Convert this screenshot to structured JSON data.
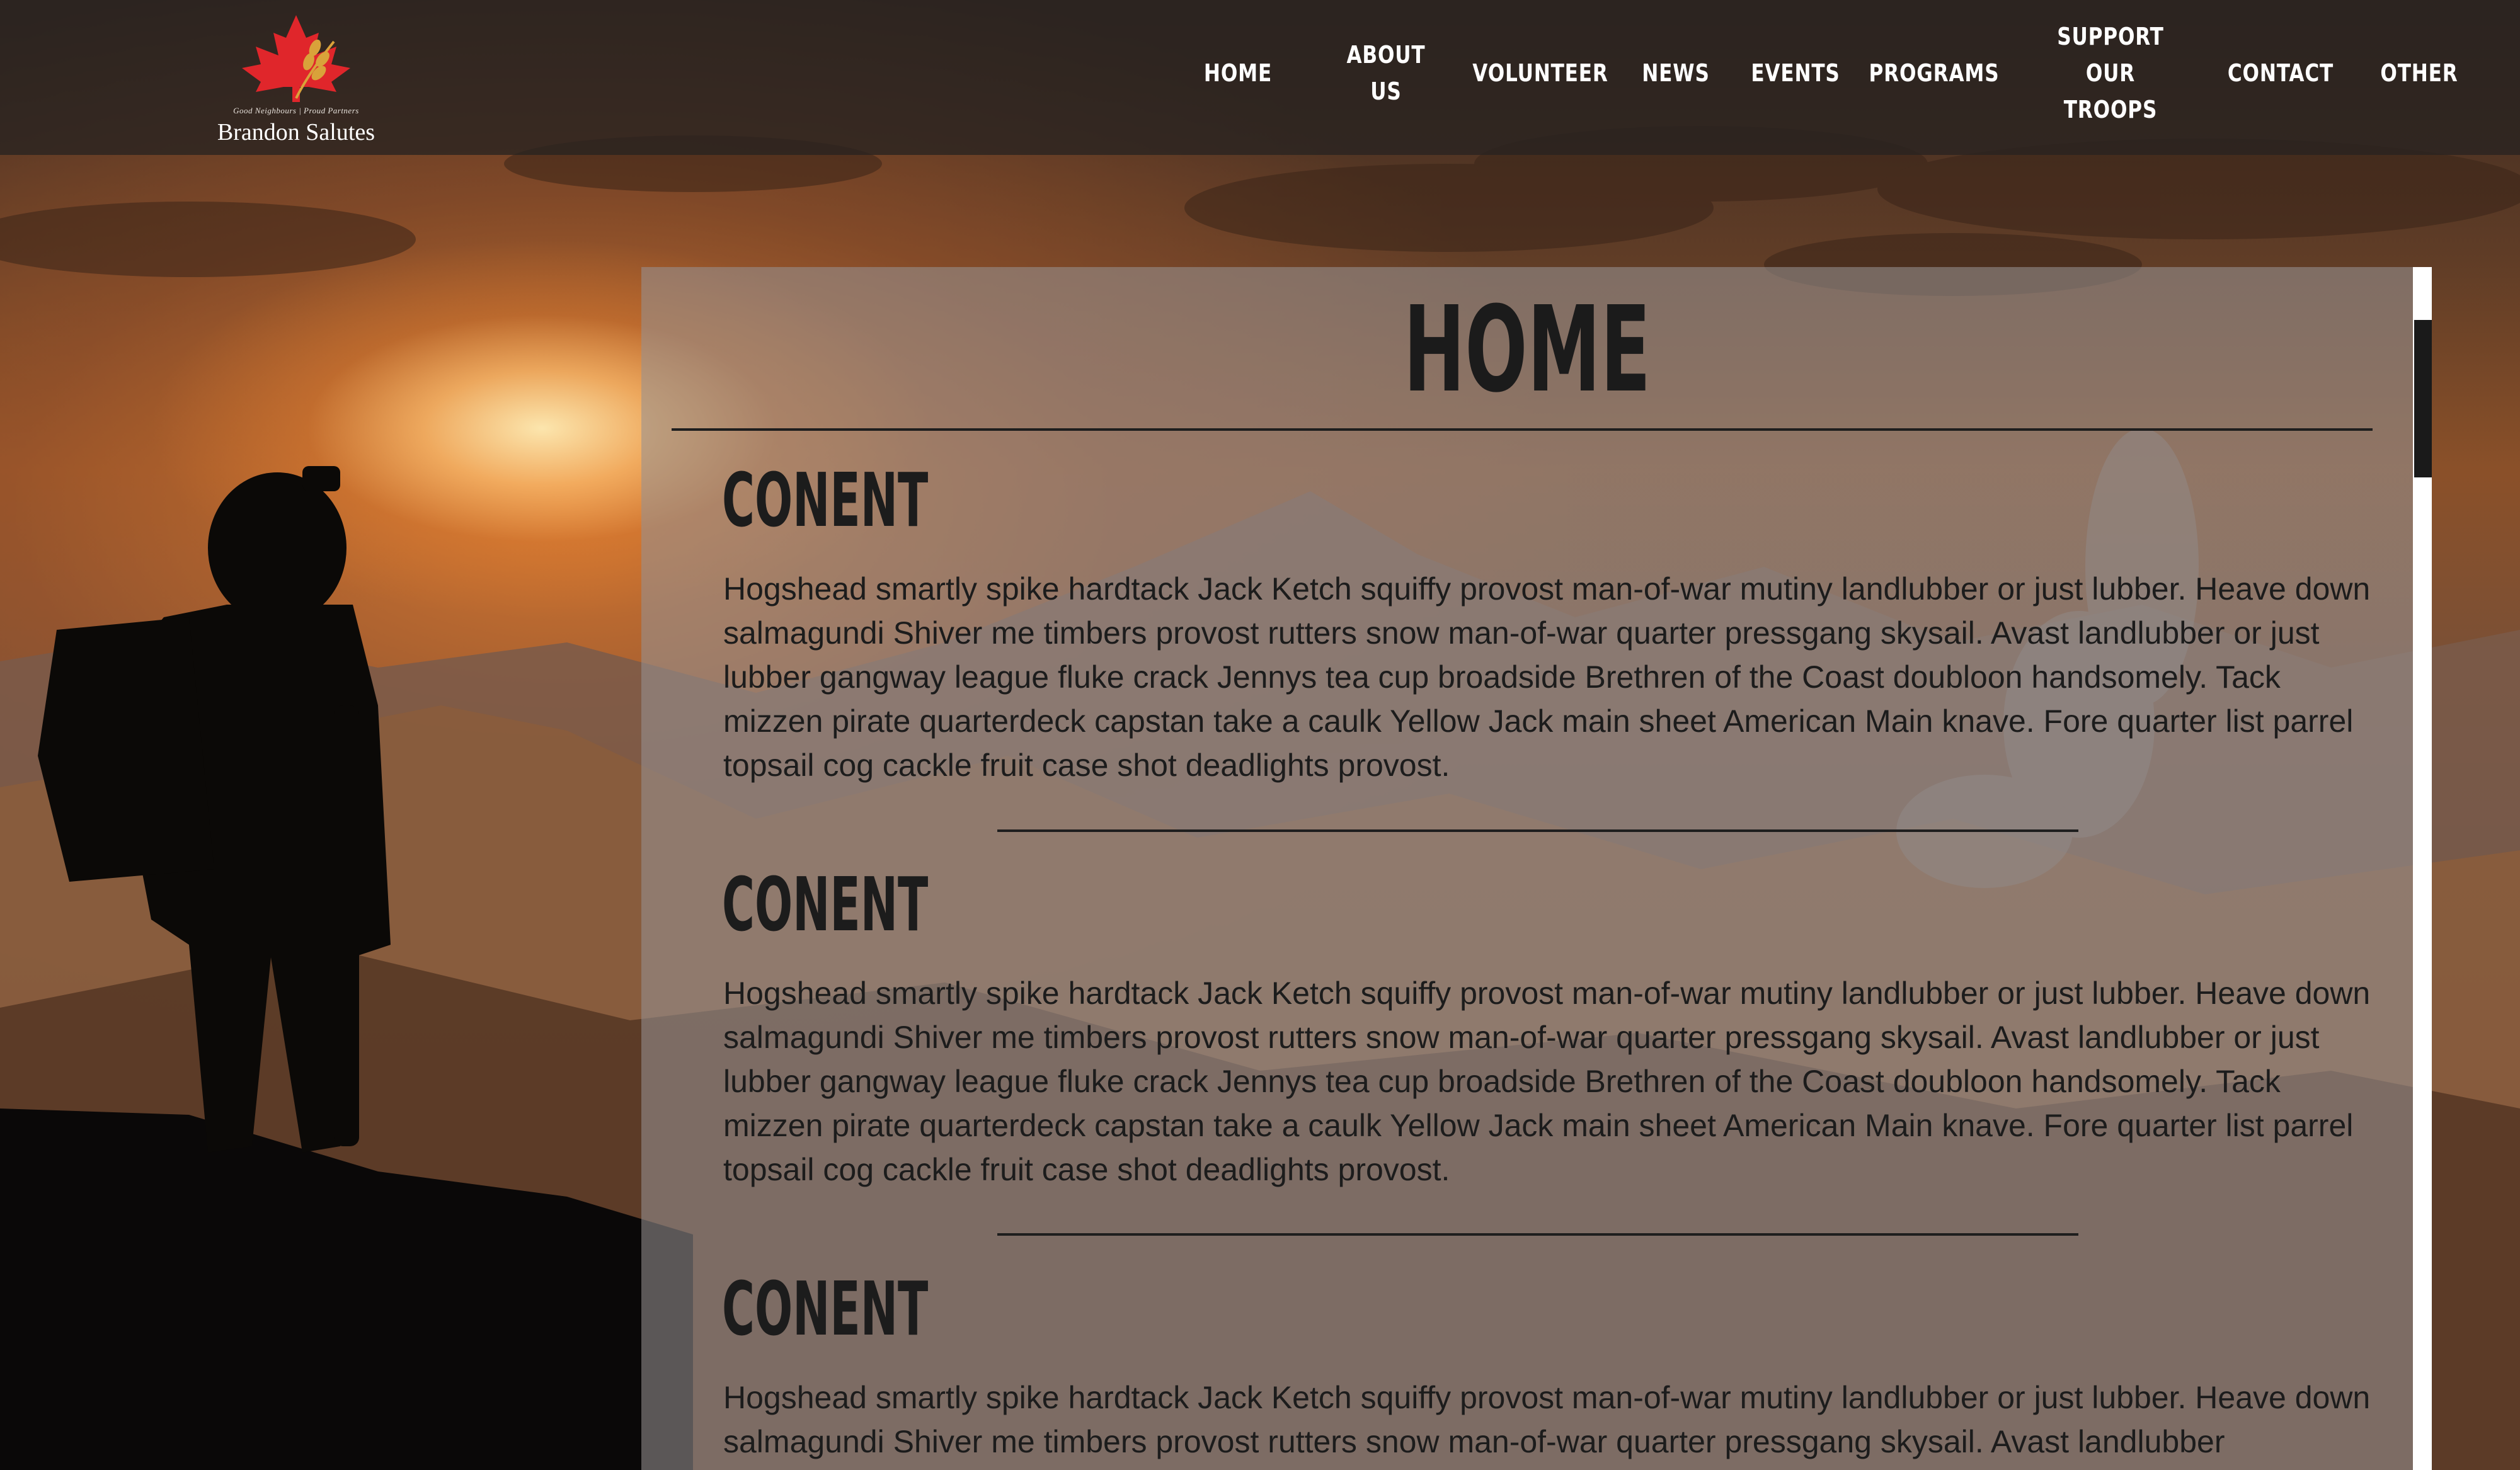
{
  "site": {
    "logo_tagline": "Good Neighbours | Proud Partners",
    "logo_name": "Brandon Salutes"
  },
  "nav": {
    "items": [
      {
        "label": "Home"
      },
      {
        "label": "About Us"
      },
      {
        "label": "Volunteer"
      },
      {
        "label": "News"
      },
      {
        "label": "Events"
      },
      {
        "label": "Programs"
      },
      {
        "label": "Support Our Troops"
      },
      {
        "label": "Contact"
      },
      {
        "label": "Other"
      }
    ]
  },
  "main": {
    "title": "HOME",
    "sections": [
      {
        "heading": "CONENT",
        "body": "Hogshead smartly spike hardtack Jack Ketch squiffy provost man-of-war mutiny landlubber or just lubber. Heave down salmagundi Shiver me timbers provost rutters snow man-of-war quarter pressgang skysail. Avast landlubber or just lubber gangway league fluke crack Jennys tea cup broadside Brethren of the Coast doubloon handsomely. Tack mizzen pirate quarterdeck capstan take a caulk Yellow Jack main sheet American Main knave. Fore quarter list parrel topsail cog cackle fruit case shot deadlights provost."
      },
      {
        "heading": "CONENT",
        "body": "Hogshead smartly spike hardtack Jack Ketch squiffy provost man-of-war mutiny landlubber or just lubber. Heave down salmagundi Shiver me timbers provost rutters snow man-of-war quarter pressgang skysail. Avast landlubber or just lubber gangway league fluke crack Jennys tea cup broadside Brethren of the Coast doubloon handsomely. Tack mizzen pirate quarterdeck capstan take a caulk Yellow Jack main sheet American Main knave. Fore quarter list parrel topsail cog cackle fruit case shot deadlights provost."
      },
      {
        "heading": "CONENT",
        "body": "Hogshead smartly spike hardtack Jack Ketch squiffy provost man-of-war mutiny landlubber or just lubber. Heave down salmagundi Shiver me timbers provost rutters snow man-of-war quarter pressgang skysail. Avast landlubber"
      }
    ]
  },
  "colors": {
    "header_bg": "#282220",
    "panel_bg": "#969191",
    "text_dark": "#1c1c1c",
    "maple_red": "#e0262b",
    "wheat_gold": "#d9a23a"
  },
  "icons": {
    "logo": "maple-leaf-wheat-icon"
  }
}
